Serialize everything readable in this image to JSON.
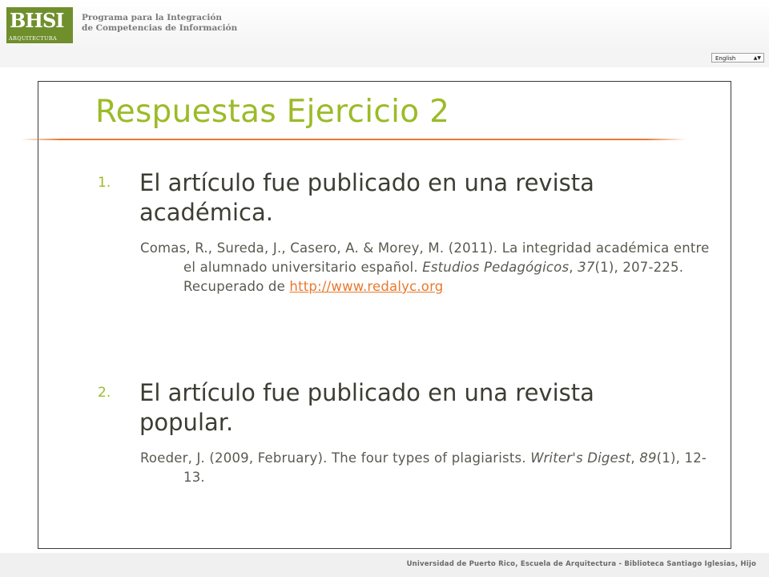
{
  "header": {
    "logo": {
      "main": "BHSI",
      "sub": "ARQUITECTURA"
    },
    "program_line1": "Programa para la Integración",
    "program_line2": "de Competencias de Información"
  },
  "language_select": {
    "value": "English"
  },
  "slide": {
    "title": "Respuestas Ejercicio 2",
    "items": [
      {
        "number": "1.",
        "text": "El artículo fue publicado en una revista académica.",
        "ref_authors": "Comas, R., Sureda, J., Casero, A. & Morey, M. (2011). La integridad académica entre el alumnado universitario español. ",
        "ref_journal": "Estudios Pedagógicos",
        "ref_sep1": ", ",
        "ref_volume": "37",
        "ref_pages": "(1), 207-225. Recuperado de ",
        "ref_link": "http://www.redalyc.org"
      },
      {
        "number": "2.",
        "text": "El artículo fue publicado en una revista popular.",
        "ref_authors": "Roeder, J. (2009, February). The four types of plagiarists. ",
        "ref_journal": "Writer's Digest",
        "ref_sep1": ", ",
        "ref_volume": "89",
        "ref_pages": "(1), 12-13."
      }
    ]
  },
  "footer": {
    "text": "Universidad de Puerto Rico, Escuela de Arquitectura - Biblioteca Santiago Iglesias, Hijo"
  },
  "colors": {
    "title": "#9bbb27",
    "rule": "#e87830",
    "link": "#e8792f",
    "logo_bg": "#6f8f2c"
  }
}
